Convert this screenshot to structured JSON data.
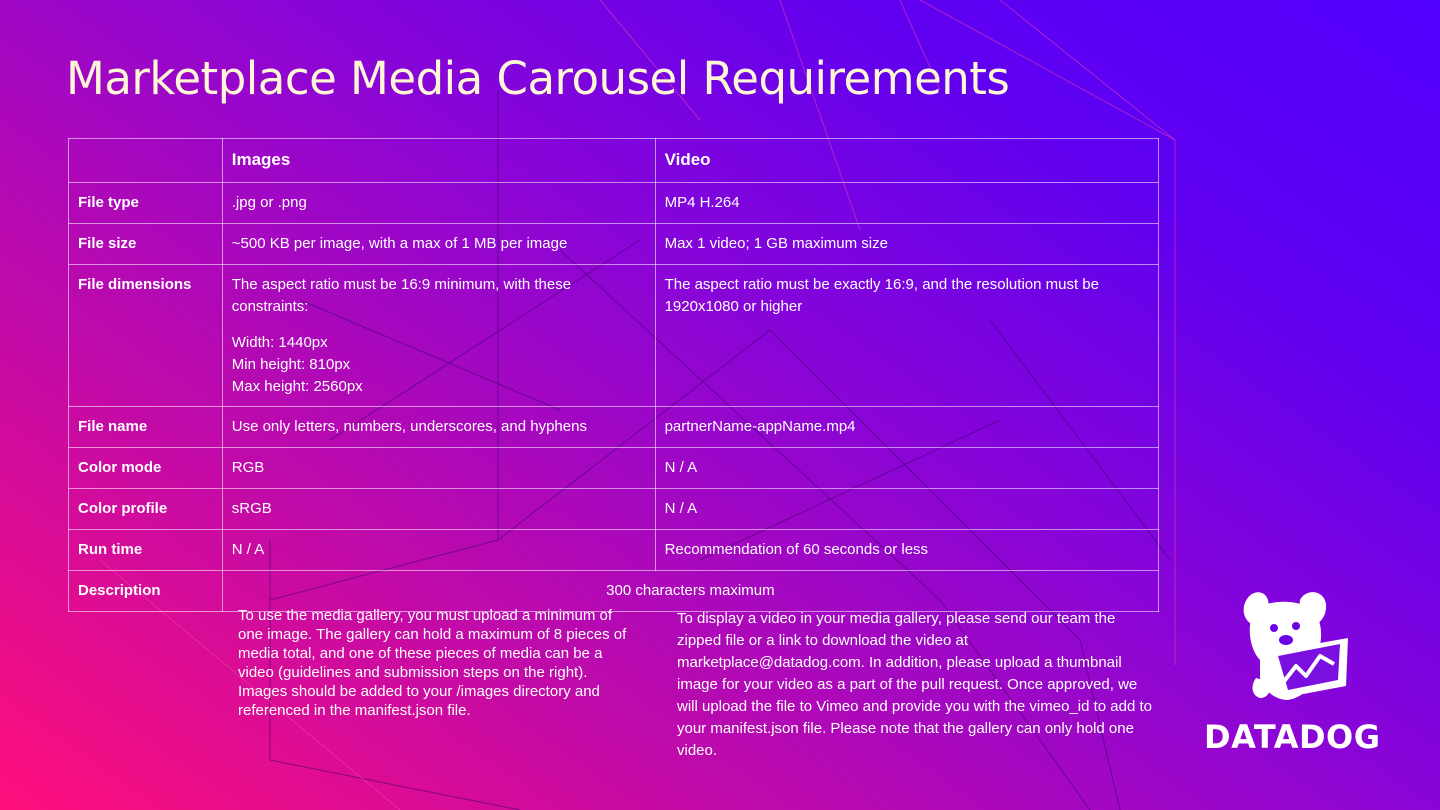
{
  "page": {
    "title": "Marketplace Media Carousel Requirements"
  },
  "table": {
    "headers": [
      "",
      "Images",
      "Video"
    ],
    "rows": [
      {
        "label": "File type",
        "images": ".jpg or .png",
        "video": "MP4 H.264"
      },
      {
        "label": "File size",
        "images": "~500 KB per image, with a max of 1 MB per image",
        "video": "Max 1 video; 1 GB maximum size"
      },
      {
        "label": "File dimensions",
        "images_intro": "The aspect ratio must be 16:9 minimum, with these constraints:",
        "images_lines": [
          "Width: 1440px",
          "Min height: 810px",
          "Max height: 2560px"
        ],
        "video": "The aspect ratio must be exactly 16:9, and the resolution must be 1920x1080 or higher"
      },
      {
        "label": "File name",
        "images": "Use only letters, numbers, underscores, and hyphens",
        "video": "partnerName-appName.mp4"
      },
      {
        "label": "Color mode",
        "images": "RGB",
        "video": "N / A"
      },
      {
        "label": "Color profile",
        "images": "sRGB",
        "video": "N / A"
      },
      {
        "label": "Run time",
        "images": "N / A",
        "video": "Recommendation of 60 seconds or less"
      },
      {
        "label": "Description",
        "merged": "300 characters maximum"
      }
    ]
  },
  "notes": {
    "left": "To use the media gallery, you must upload a minimum of one image. The gallery can hold a maximum of 8 pieces of media total, and one of these pieces of media can be a video (guidelines and submission steps on the right). Images should be added to your /images directory and referenced in the manifest.json file.",
    "right": "To display a video in your media gallery, please send our team the zipped file or a link to download the video at marketplace@datadog.com. In addition, please upload a thumbnail image for your video as a part of the pull request. Once approved, we will upload the file to Vimeo and provide you with the vimeo_id to add to your manifest.json file.  Please note that the gallery can only hold one video."
  },
  "logo": {
    "icon": "datadog-dog-icon",
    "wordmark": "DATADOG"
  },
  "colors": {
    "gradient_start": "#ff0f7b",
    "gradient_mid": "#8a05d6",
    "gradient_end": "#5200ff",
    "title_color": "#fff6d6"
  }
}
